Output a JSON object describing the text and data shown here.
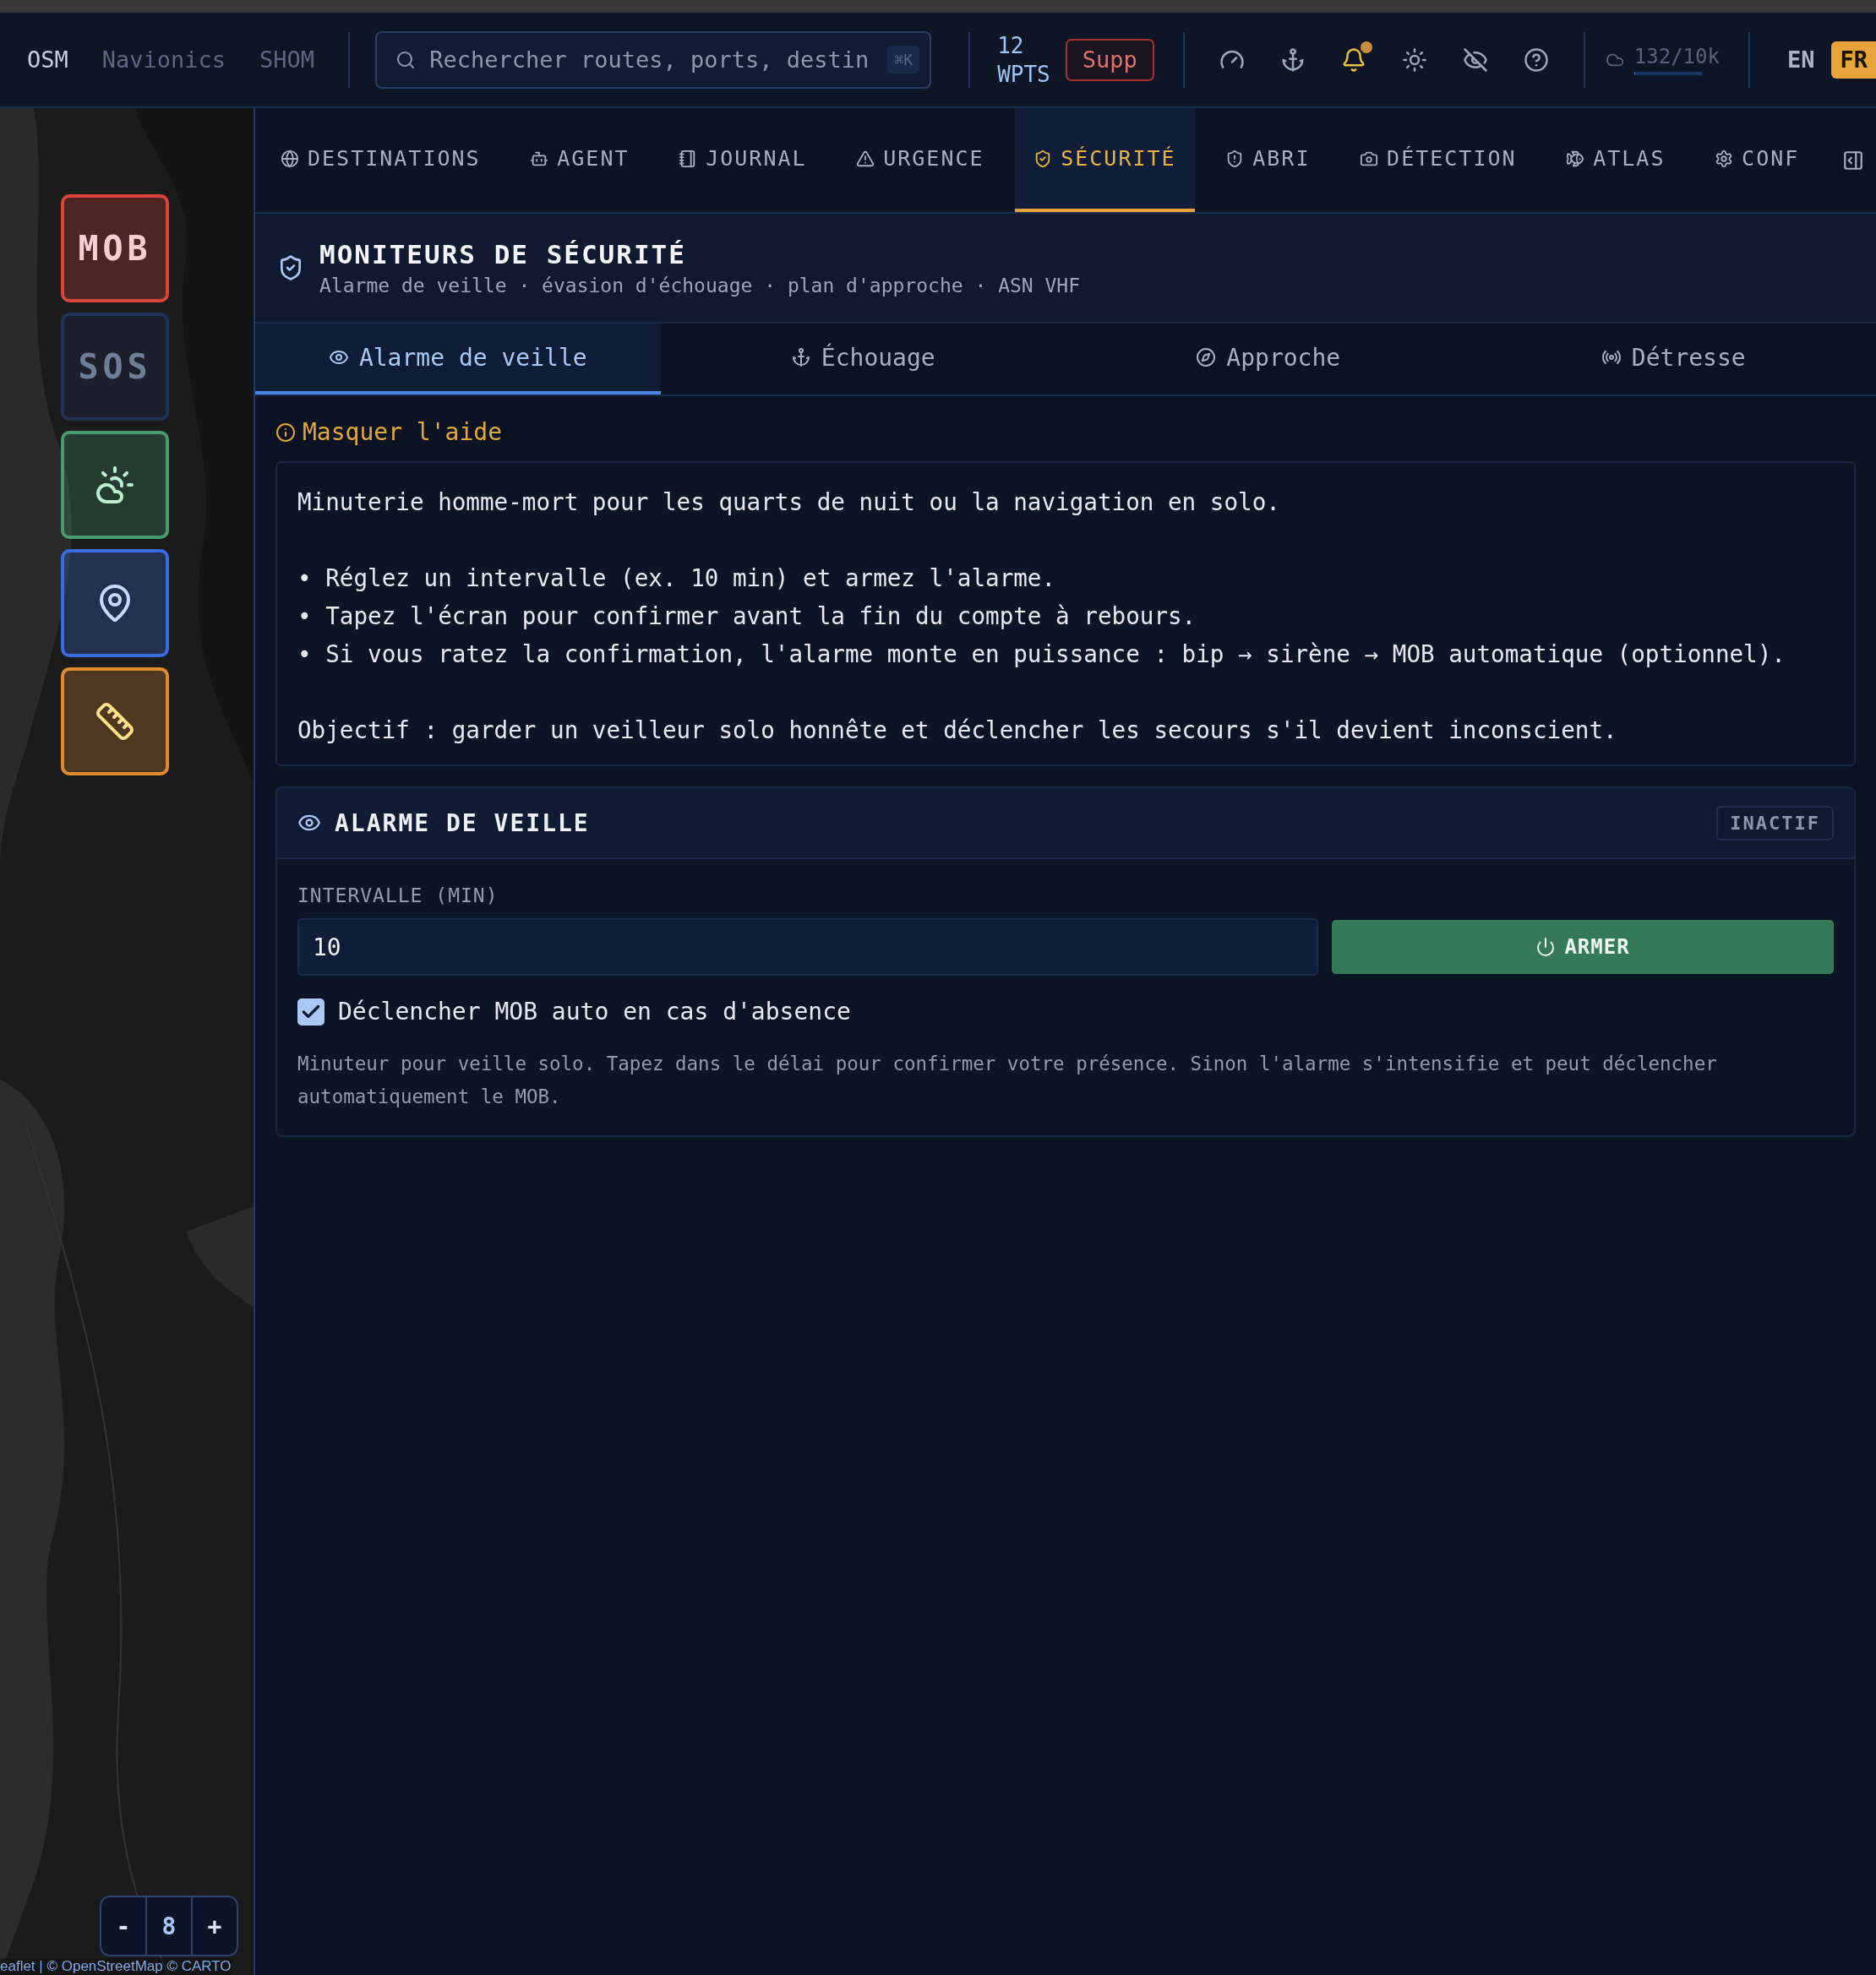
{
  "top_bar": {
    "map_layers": [
      {
        "label": "OSM",
        "selected": true
      },
      {
        "label": "Navionics",
        "selected": false
      },
      {
        "label": "SHOM",
        "selected": false
      }
    ],
    "search": {
      "placeholder": "Rechercher routes, ports, destin",
      "shortcut": "⌘K"
    },
    "waypoints": {
      "count": "12",
      "unit": "WPTS"
    },
    "delete_button": "Supp",
    "notifications_unread": true,
    "quota": {
      "reading": "132/10k",
      "level": 0.013
    },
    "languages": [
      {
        "label": "EN",
        "selected": false
      },
      {
        "label": "FR",
        "selected": true
      }
    ]
  },
  "map": {
    "buttons": [
      {
        "kind": "label",
        "label": "MOB",
        "color": "#d9453b"
      },
      {
        "kind": "label",
        "label": "SOS",
        "color": "#1f3257"
      },
      {
        "kind": "weather",
        "color": "#4a9a6c"
      },
      {
        "kind": "location",
        "color": "#3b6be0"
      },
      {
        "kind": "measure",
        "color": "#e08a30"
      }
    ],
    "zoom": {
      "minus": "-",
      "level": "8",
      "plus": "+"
    },
    "attribution": "eaflet | © OpenStreetMap © CARTO"
  },
  "nav_tabs": [
    {
      "label": "DESTINATIONS",
      "selected": false
    },
    {
      "label": "AGENT",
      "selected": false
    },
    {
      "label": "JOURNAL",
      "selected": false
    },
    {
      "label": "URGENCE",
      "selected": false
    },
    {
      "label": "SÉCURITÉ",
      "selected": true
    },
    {
      "label": "ABRI",
      "selected": false
    },
    {
      "label": "DÉTECTION",
      "selected": false
    },
    {
      "label": "ATLAS",
      "selected": false
    },
    {
      "label": "CONF",
      "selected": false
    }
  ],
  "panel": {
    "title": "MONITEURS DE SÉCURITÉ",
    "subtitle": "Alarme de veille · évasion d'échouage · plan d'approche · ASN VHF",
    "tabs": [
      {
        "label": "Alarme de veille",
        "selected": true
      },
      {
        "label": "Échouage",
        "selected": false
      },
      {
        "label": "Approche",
        "selected": false
      },
      {
        "label": "Détresse",
        "selected": false
      }
    ],
    "help_toggle": "Masquer l'aide",
    "help": {
      "intro": "Minuterie homme-mort pour les quarts de nuit ou la navigation en solo.",
      "bullets": [
        "• Réglez un intervalle (ex. 10 min) et armez l'alarme.",
        "• Tapez l'écran pour confirmer avant la fin du compte à rebours.",
        "• Si vous ratez la confirmation, l'alarme monte en puissance : bip → sirène → MOB automatique (optionnel)."
      ],
      "goal": "Objectif : garder un veilleur solo honnête et déclencher les secours s'il devient inconscient."
    },
    "card": {
      "title": "ALARME DE VEILLE",
      "status": "INACTIF",
      "interval_label": "INTERVALLE (MIN)",
      "interval_value": "10",
      "arm_button": "ARMER",
      "auto_mob": {
        "label": "Déclencher MOB auto en cas d'absence",
        "checked": true
      },
      "note": "Minuteur pour veille solo. Tapez dans le délai pour confirmer votre présence. Sinon l'alarme s'intensifie et peut déclencher automatiquement le MOB."
    }
  }
}
